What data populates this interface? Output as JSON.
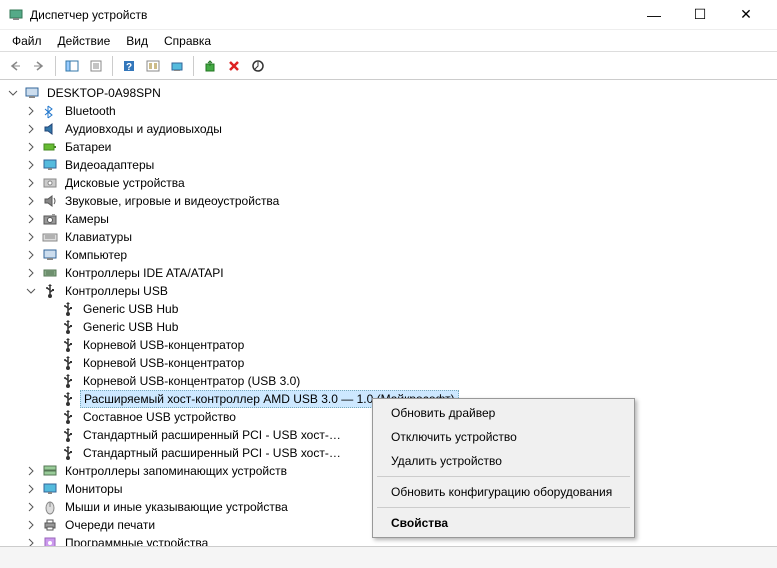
{
  "window": {
    "title": "Диспетчер устройств"
  },
  "menu": {
    "file": "Файл",
    "action": "Действие",
    "view": "Вид",
    "help": "Справка"
  },
  "tree": {
    "root": "DESKTOP-0A98SPN",
    "items": [
      {
        "label": "Bluetooth",
        "icon": "bluetooth",
        "expanded": false
      },
      {
        "label": "Аудиовходы и аудиовыходы",
        "icon": "audio",
        "expanded": false
      },
      {
        "label": "Батареи",
        "icon": "battery",
        "expanded": false
      },
      {
        "label": "Видеоадаптеры",
        "icon": "display",
        "expanded": false
      },
      {
        "label": "Дисковые устройства",
        "icon": "disk",
        "expanded": false
      },
      {
        "label": "Звуковые, игровые и видеоустройства",
        "icon": "sound",
        "expanded": false
      },
      {
        "label": "Камеры",
        "icon": "camera",
        "expanded": false
      },
      {
        "label": "Клавиатуры",
        "icon": "keyboard",
        "expanded": false
      },
      {
        "label": "Компьютер",
        "icon": "computer",
        "expanded": false
      },
      {
        "label": "Контроллеры IDE ATA/ATAPI",
        "icon": "ide",
        "expanded": false
      },
      {
        "label": "Контроллеры USB",
        "icon": "usb",
        "expanded": true,
        "children": [
          {
            "label": "Generic USB Hub",
            "icon": "usb"
          },
          {
            "label": "Generic USB Hub",
            "icon": "usb"
          },
          {
            "label": "Корневой USB-концентратор",
            "icon": "usb"
          },
          {
            "label": "Корневой USB-концентратор",
            "icon": "usb"
          },
          {
            "label": "Корневой USB-концентратор (USB 3.0)",
            "icon": "usb"
          },
          {
            "label": "Расширяемый хост-контроллер AMD USB 3.0 — 1.0 (Майкрософт)",
            "icon": "usb",
            "selected": true
          },
          {
            "label": "Составное USB устройство",
            "icon": "usb"
          },
          {
            "label": "Стандартный расширенный PCI - USB хост-…",
            "icon": "usb"
          },
          {
            "label": "Стандартный расширенный PCI - USB хост-…",
            "icon": "usb"
          }
        ]
      },
      {
        "label": "Контроллеры запоминающих устройств",
        "icon": "storage",
        "expanded": false
      },
      {
        "label": "Мониторы",
        "icon": "monitor",
        "expanded": false
      },
      {
        "label": "Мыши и иные указывающие устройства",
        "icon": "mouse",
        "expanded": false
      },
      {
        "label": "Очереди печати",
        "icon": "print",
        "expanded": false
      },
      {
        "label": "Программные устройства",
        "icon": "software",
        "expanded": false
      }
    ]
  },
  "context": {
    "update_driver": "Обновить драйвер",
    "disable": "Отключить устройство",
    "uninstall": "Удалить устройство",
    "scan": "Обновить конфигурацию оборудования",
    "properties": "Свойства"
  }
}
